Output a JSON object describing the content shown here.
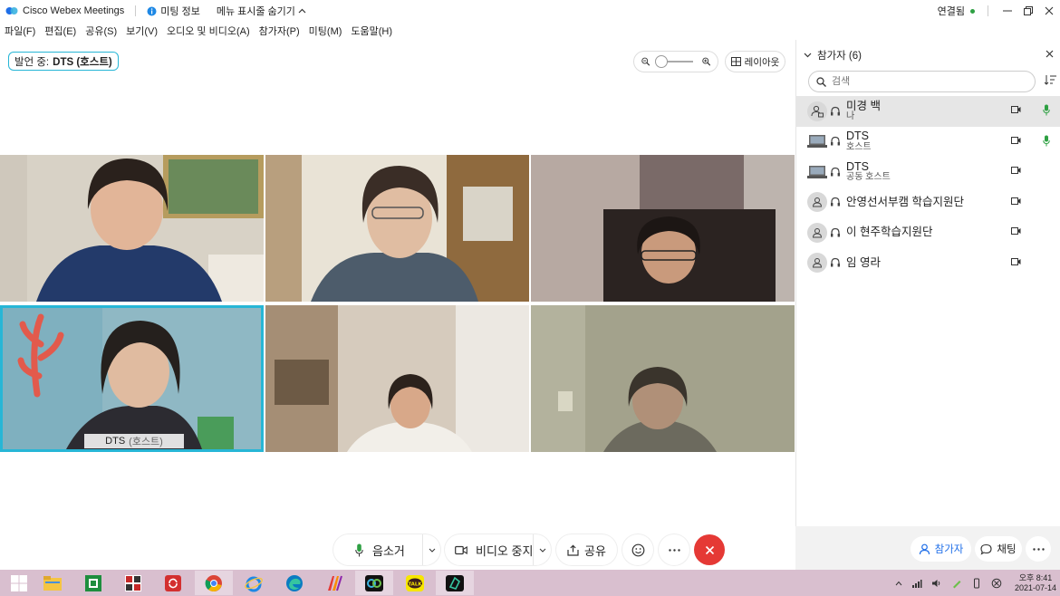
{
  "window": {
    "app_title": "Cisco Webex Meetings",
    "meeting_info": "미팅 정보",
    "hide_menu": "메뉴 표시줄 숨기기",
    "connection": "연결됨",
    "connection_color": "#2ea043"
  },
  "menu": {
    "items": [
      "파일(F)",
      "편집(E)",
      "공유(S)",
      "보기(V)",
      "오디오 및 비디오(A)",
      "참가자(P)",
      "미팅(M)",
      "도움말(H)"
    ]
  },
  "stage": {
    "speaking_label": "발언 중:",
    "speaking_name": "DTS (호스트)",
    "layout_label": "레이아웃",
    "active_tile_name": "DTS",
    "active_tile_role": "(호스트)",
    "accent": "#27b6d6"
  },
  "participants_panel": {
    "title": "참가자 (6)",
    "search_placeholder": "검색",
    "list": [
      {
        "name": "미경 백",
        "role": "나",
        "avatar": "person-share-icon",
        "mic_on": true
      },
      {
        "name": "DTS",
        "role": "호스트",
        "avatar": "laptop-icon",
        "mic_on": true
      },
      {
        "name": "DTS",
        "role": "공동 호스트",
        "avatar": "laptop-icon",
        "mic_on": false
      },
      {
        "name": "안영선서부캠 학습지원단",
        "role": "",
        "avatar": "person-icon",
        "mic_on": false
      },
      {
        "name": "이 현주학습지원단",
        "role": "",
        "avatar": "person-icon",
        "mic_on": false
      },
      {
        "name": "임 영라",
        "role": "",
        "avatar": "person-icon",
        "mic_on": false
      }
    ],
    "bottom": {
      "participants": "참가자",
      "chat": "채팅"
    }
  },
  "controls": {
    "mute": "음소거",
    "stop_video": "비디오 중지",
    "share": "공유",
    "end_color": "#e53935"
  },
  "taskbar": {
    "time": "오후 8:41",
    "date": "2021-07-14"
  }
}
